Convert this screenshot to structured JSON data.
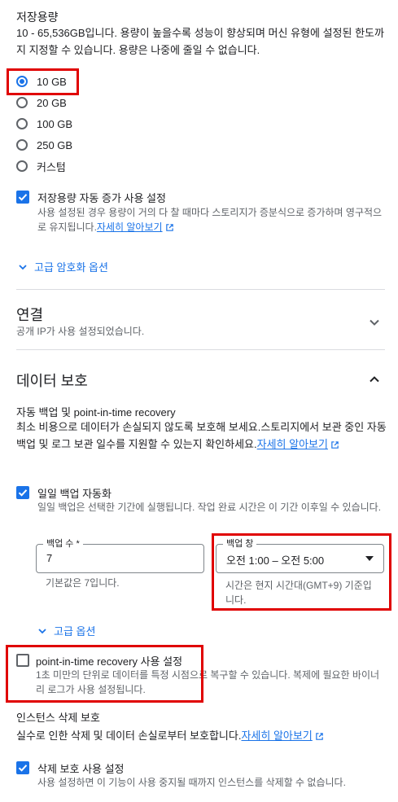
{
  "storage": {
    "title": "저장용량",
    "description": "10 - 65,536GB입니다. 용량이 높을수록 성능이 향상되며 머신 유형에 설정된 한도까지 지정할 수 있습니다. 용량은 나중에 줄일 수 없습니다.",
    "options": [
      "10 GB",
      "20 GB",
      "100 GB",
      "250 GB",
      "커스텀"
    ],
    "selected": "10 GB",
    "auto_increase": {
      "label": "저장용량 자동 증가 사용 설정",
      "checked": true,
      "description": "사용 설정된 경우 용량이 거의 다 찰 때마다 스토리지가 증분식으로 증가하며 영구적으로 유지됩니다.",
      "link": "자세히 알아보기"
    },
    "advanced_encryption": "고급 암호화 옵션"
  },
  "connection": {
    "title": "연결",
    "subtitle": "공개 IP가 사용 설정되었습니다."
  },
  "data_protection": {
    "title": "데이터 보호",
    "backup_heading": "자동 백업 및 point-in-time recovery",
    "backup_desc": "최소 비용으로 데이터가 손실되지 않도록 보호해 보세요.스토리지에서 보관 중인 자동 백업 및 로그 보관 일수를 지원할 수 있는지 확인하세요.",
    "backup_link": "자세히 알아보기",
    "daily_backup": {
      "label": "일일 백업 자동화",
      "checked": true,
      "description": "일일 백업은 선택한 기간에 실행됩니다. 작업 완료 시간은 이 기간 이후일 수 있습니다."
    },
    "backup_count": {
      "label": "백업 수 *",
      "value": "7",
      "helper": "기본값은 7입니다."
    },
    "backup_window": {
      "label": "백업 창",
      "value": "오전 1:00 – 오전 5:00",
      "helper": "시간은 현지 시간대(GMT+9) 기준입니다."
    },
    "advanced_options": "고급 옵션",
    "pitr": {
      "label": "point-in-time recovery 사용 설정",
      "checked": false,
      "description": "1초 미만의 단위로 데이터를 특정 시점으로 복구할 수 있습니다. 복제에 필요한 바이너리 로그가 사용 설정됩니다."
    },
    "deletion_protection": {
      "heading": "인스턴스 삭제 보호",
      "desc": "실수로 인한 삭제 및 데이터 손실로부터 보호합니다.",
      "link": "자세히 알아보기",
      "label": "삭제 보호 사용 설정",
      "checked": true,
      "description": "사용 설정하면 이 기능이 사용 중지될 때까지 인스턴스를 삭제할 수 없습니다."
    }
  },
  "colors": {
    "accent": "#1a73e8",
    "highlight": "#e00000"
  }
}
